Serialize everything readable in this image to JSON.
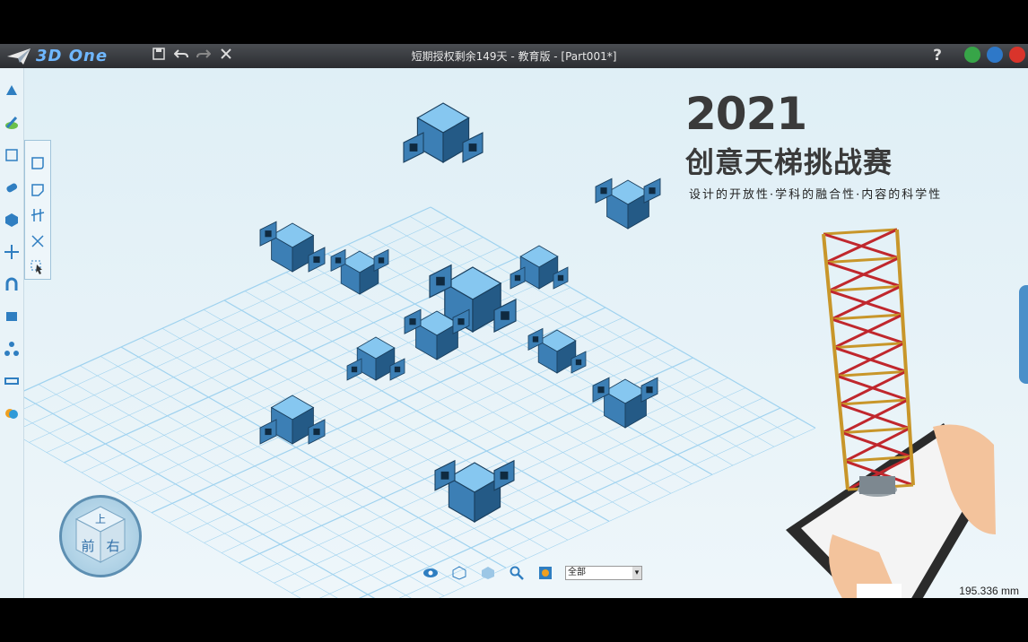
{
  "app": {
    "logo_text": "3D One",
    "window_title": "短期授权剩余149天 - 教育版 - [Part001*]"
  },
  "toolbar": {
    "save": "save-icon",
    "undo": "undo-icon",
    "redo": "redo-icon",
    "close": "close-icon"
  },
  "window_controls": {
    "help": "?",
    "minimize_color": "#37a548",
    "restore_color": "#2e78c8",
    "close_color": "#d9342b"
  },
  "banner": {
    "year": "2021",
    "title": "创意天梯挑战赛",
    "subtitle": "设计的开放性·学科的融合性·内容的科学性"
  },
  "viewcube": {
    "top": "上",
    "front": "前",
    "right": "右"
  },
  "bottom_toolbar": {
    "filter_value": "全部"
  },
  "status": {
    "measure": "195.336 mm"
  },
  "colors": {
    "part_top": "#86c7f0",
    "part_left": "#3c7fb5",
    "part_right": "#245a86",
    "grid": "#9fd2ef",
    "accent": "#4a8fc9"
  }
}
